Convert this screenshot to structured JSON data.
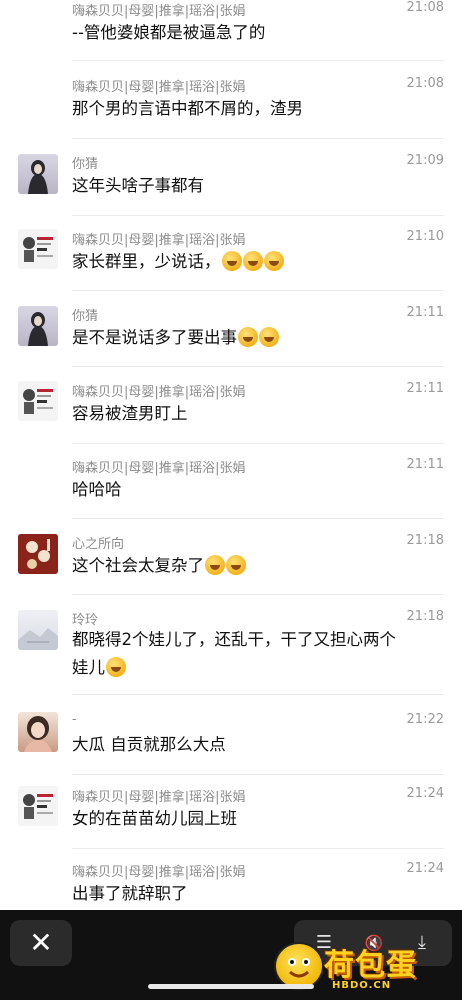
{
  "messages": [
    {
      "sender": "嗨森贝贝|母婴|推拿|瑶浴|张娟",
      "time": "21:08",
      "text": "--管他婆娘都是被逼急了的",
      "avatar": "none"
    },
    {
      "sender": "嗨森贝贝|母婴|推拿|瑶浴|张娟",
      "time": "21:08",
      "text": "那个男的言语中都不屑的，渣男",
      "avatar": "none"
    },
    {
      "sender": "你猜",
      "time": "21:09",
      "text": "这年头啥子事都有",
      "avatar": "girl-photo"
    },
    {
      "sender": "嗨森贝贝|母婴|推拿|瑶浴|张娟",
      "time": "21:10",
      "text": "家长群里，少说话，",
      "emoji_count": 3,
      "avatar": "business-card"
    },
    {
      "sender": "你猜",
      "time": "21:11",
      "text": "是不是说话多了要出事",
      "emoji_count": 2,
      "avatar": "girl-photo"
    },
    {
      "sender": "嗨森贝贝|母婴|推拿|瑶浴|张娟",
      "time": "21:11",
      "text": "容易被渣男盯上",
      "avatar": "business-card"
    },
    {
      "sender": "嗨森贝贝|母婴|推拿|瑶浴|张娟",
      "time": "21:11",
      "text": "哈哈哈",
      "avatar": "none"
    },
    {
      "sender": "心之所向",
      "time": "21:18",
      "text": "这个社会太复杂了",
      "emoji_count": 2,
      "avatar": "red-art"
    },
    {
      "sender": "玲玲",
      "time": "21:18",
      "text": "都晓得2个娃儿了，还乱干，干了又担心两个",
      "text2": "娃儿",
      "emoji_count": 1,
      "avatar": "landscape"
    },
    {
      "sender": "-",
      "time": "21:22",
      "text": "大瓜 自贡就那么大点",
      "avatar": "woman-photo"
    },
    {
      "sender": "嗨森贝贝|母婴|推拿|瑶浴|张娟",
      "time": "21:24",
      "text": "女的在苗苗幼儿园上班",
      "avatar": "business-card"
    },
    {
      "sender": "嗨森贝贝|母婴|推拿|瑶浴|张娟",
      "time": "21:24",
      "text": "出事了就辞职了",
      "avatar": "none"
    }
  ],
  "bottom_bar": {
    "close_icon": "close-icon",
    "controls": [
      "list-icon",
      "mute-icon",
      "download-icon"
    ],
    "close_glyph": "✕",
    "list_glyph": "☰",
    "mute_glyph": "🔇",
    "download_glyph": "⤓"
  },
  "watermark": {
    "main": "荷包蛋",
    "sub": "HBDO.CN"
  },
  "colors": {
    "background": "#ffffff",
    "meta_text": "#8c8c8c",
    "bar": "#111111",
    "logo": "#ffd21f"
  }
}
